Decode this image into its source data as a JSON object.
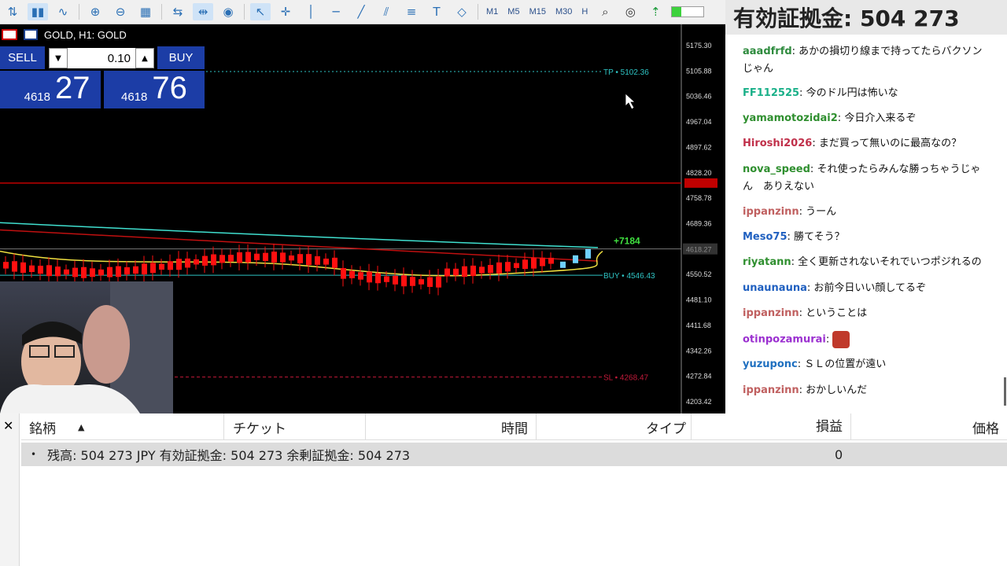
{
  "toolbar": {
    "icons": [
      "chart-bar-icon",
      "candles-icon",
      "line-chart-icon",
      "zoom-in-icon",
      "zoom-out-icon",
      "grid-icon",
      "autoscroll-icon",
      "chart-shift-icon",
      "screenshot-icon",
      "cursor-icon",
      "crosshair-icon",
      "vertical-line-icon",
      "horizontal-line-icon",
      "trendline-icon",
      "channel-icon",
      "fibonacci-icon",
      "text-icon",
      "shapes-icon"
    ],
    "timeframes": [
      "M1",
      "M5",
      "M15",
      "M30",
      "H"
    ],
    "right_icons": [
      "search-icon",
      "account-icon",
      "signal-icon"
    ]
  },
  "chart": {
    "title": "GOLD, H1:  GOLD",
    "sell_label": "SELL",
    "buy_label": "BUY",
    "lot_value": "0.10",
    "sell_price_prefix": "4618",
    "sell_price_big": "27",
    "buy_price_prefix": "4618",
    "buy_price_big": "76",
    "tp_label": "TP • 5102.36",
    "buy_line_label": "BUY • 4546.43",
    "sl_label": "SL • 4268.47",
    "profit_label": "+7184",
    "current_price": "4618.27",
    "price_axis": [
      "5175.30",
      "5105.88",
      "5036.46",
      "4967.04",
      "4897.62",
      "4828.20",
      "4758.78",
      "4689.36",
      "4618.27",
      "4550.52",
      "4481.10",
      "4411.68",
      "4342.26",
      "4272.84",
      "4203.42"
    ],
    "colors": {
      "tp": "#2ec4c4",
      "buy": "#2ec4c4",
      "sl": "#c41a3a",
      "bear": "#ff1010",
      "bull": "#6fd0ff",
      "ma_red": "#c01010",
      "ma_cyan": "#40e0d0",
      "ma_yellow": "#f0e040"
    }
  },
  "chat": {
    "header": "有効証拠金: 504 273",
    "messages": [
      {
        "user": "aaadfrfd",
        "color": "#2e8b3e",
        "text": "あかの損切り線まで持ってたらバクソン"
      },
      {
        "user": "",
        "color": "#111",
        "text": "じゃん"
      },
      {
        "user": "FF112525",
        "color": "#1ab089",
        "text": "今のドル円は怖いな"
      },
      {
        "user": "yamamotozidai2",
        "color": "#2f8f2f",
        "text": "今日介入来るぞ"
      },
      {
        "user": "Hiroshi2026",
        "color": "#c0304a",
        "text": "まだ買って無いのに最高なの？"
      },
      {
        "user": "nova_speed",
        "color": "#2f8f2f",
        "text": "それ使ったらみんな勝っちゃうじゃ"
      },
      {
        "user": "",
        "color": "#111",
        "text": "ん　ありえない"
      },
      {
        "user": "ippanzinn",
        "color": "#c06060",
        "text": "うーん"
      },
      {
        "user": "Meso75",
        "color": "#2060c0",
        "text": "勝てそう？"
      },
      {
        "user": "riyatann",
        "color": "#2f8f2f",
        "text": "全く更新されないそれでいつポジれるの"
      },
      {
        "user": "unaunauna",
        "color": "#2060c0",
        "text": "お前今日いい顔してるぞ"
      },
      {
        "user": "ippanzinn",
        "color": "#c06060",
        "text": "ということは"
      },
      {
        "user": "otinpozamurai",
        "color": "#9b30d0",
        "text": ""
      },
      {
        "user": "yuzuponc",
        "color": "#2070c0",
        "text": "ＳＬの位置が遠い"
      },
      {
        "user": "ippanzinn",
        "color": "#c06060",
        "text": "おかしいんだ"
      }
    ]
  },
  "terminal": {
    "columns": [
      "銘柄",
      "チケット",
      "時間",
      "タイプ",
      "損益",
      "価格"
    ],
    "balance_row": "残高: 504 273 JPY  有効証拠金: 504 273  余剰証拠金: 504 273",
    "balance_pl": "0"
  }
}
